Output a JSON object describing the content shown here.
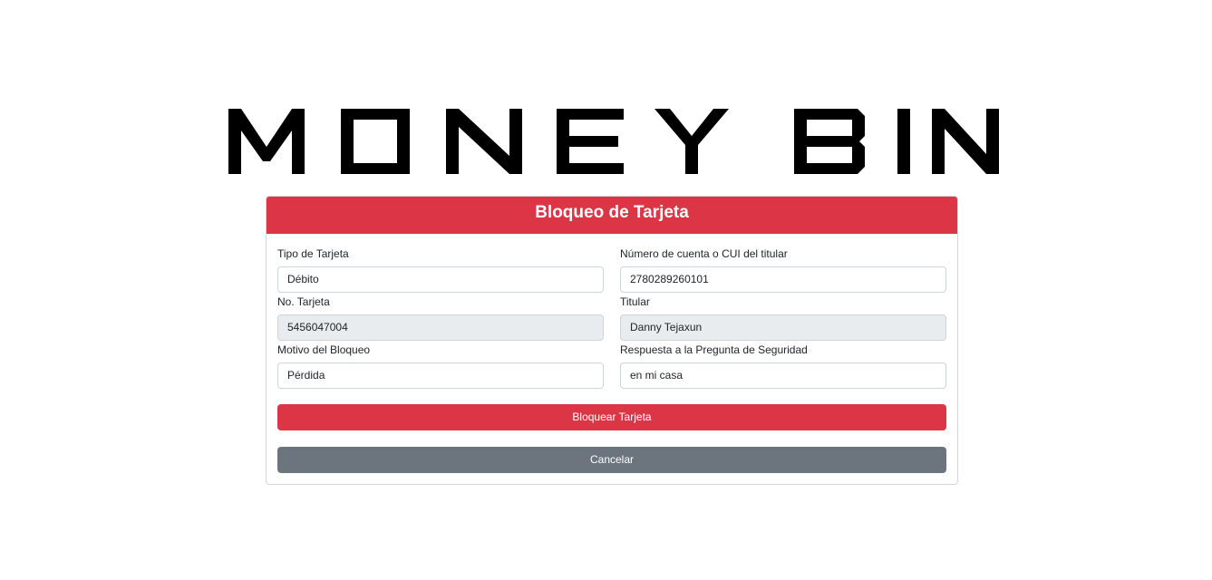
{
  "logo": {
    "text": "MONEY BIN"
  },
  "card": {
    "title": "Bloqueo de Tarjeta"
  },
  "form": {
    "tipo_tarjeta": {
      "label": "Tipo de Tarjeta",
      "value": "Débito"
    },
    "cuenta_cui": {
      "label": "Número de cuenta o CUI del titular",
      "value": "2780289260101"
    },
    "no_tarjeta": {
      "label": "No. Tarjeta",
      "value": "5456047004"
    },
    "titular": {
      "label": "Titular",
      "value": "Danny Tejaxun"
    },
    "motivo": {
      "label": "Motivo del Bloqueo",
      "value": "Pérdida"
    },
    "respuesta": {
      "label": "Respuesta a la Pregunta de Seguridad",
      "value": "en mi casa"
    }
  },
  "buttons": {
    "bloquear": "Bloquear Tarjeta",
    "cancelar": "Cancelar"
  },
  "colors": {
    "danger": "#dc3545",
    "secondary": "#6c757d",
    "readonly_bg": "#e9ecef"
  }
}
